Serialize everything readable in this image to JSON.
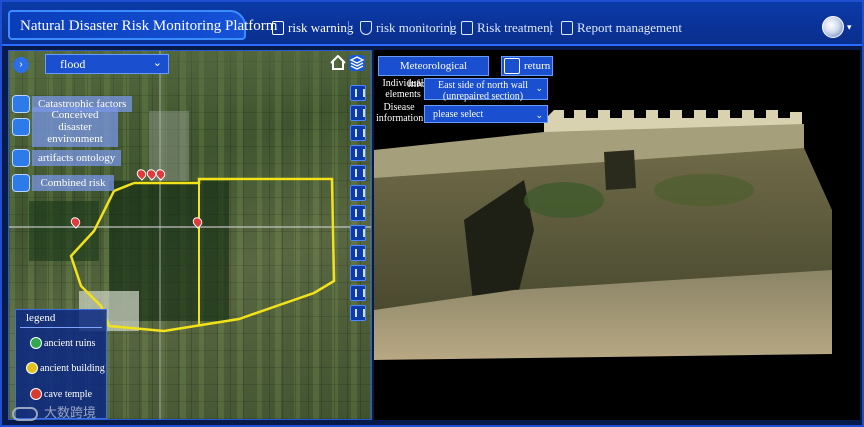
{
  "header": {
    "title": "Natural Disaster Risk Monitoring Platform",
    "nav": [
      {
        "label": "risk warning",
        "active": true,
        "icon": "phone-warning-icon"
      },
      {
        "label": "risk monitoring",
        "active": false,
        "icon": "shield-check-icon"
      },
      {
        "label": "Risk treatment",
        "active": false,
        "icon": "clipboard-icon"
      },
      {
        "label": "Report management",
        "active": false,
        "icon": "document-icon"
      }
    ],
    "user_icon": "user-avatar-icon"
  },
  "map_panel": {
    "hazard_select": {
      "value": "flood"
    },
    "side_buttons": [
      {
        "label": "Catastrophic factors",
        "icon": "factors-icon"
      },
      {
        "label": "Conceived disaster environment",
        "icon": "environment-icon"
      },
      {
        "label": "artifacts ontology",
        "icon": "ontology-icon"
      },
      {
        "label": "Combined risk",
        "icon": "combined-risk-icon"
      }
    ],
    "legend": {
      "title": "legend",
      "items": [
        {
          "label": "ancient ruins",
          "color": "#2fa84f"
        },
        {
          "label": "ancient building",
          "color": "#e0c21a"
        },
        {
          "label": "cave temple",
          "color": "#d93a2e"
        }
      ]
    },
    "boundary_color": "#f2e21a"
  },
  "right_panel": {
    "meteorological_button": "Meteorological information",
    "return_button": "return",
    "individual_elements": {
      "label": "Individual elements",
      "value": "East side of north wall (unrepaired section)"
    },
    "disease_information": {
      "label": "Disease information",
      "value": "please select"
    }
  },
  "watermark": "大数跨境",
  "colors": {
    "header_bg": "#0b3aa8",
    "accent": "#2a6cff",
    "panel_bg": "#071a4a"
  }
}
